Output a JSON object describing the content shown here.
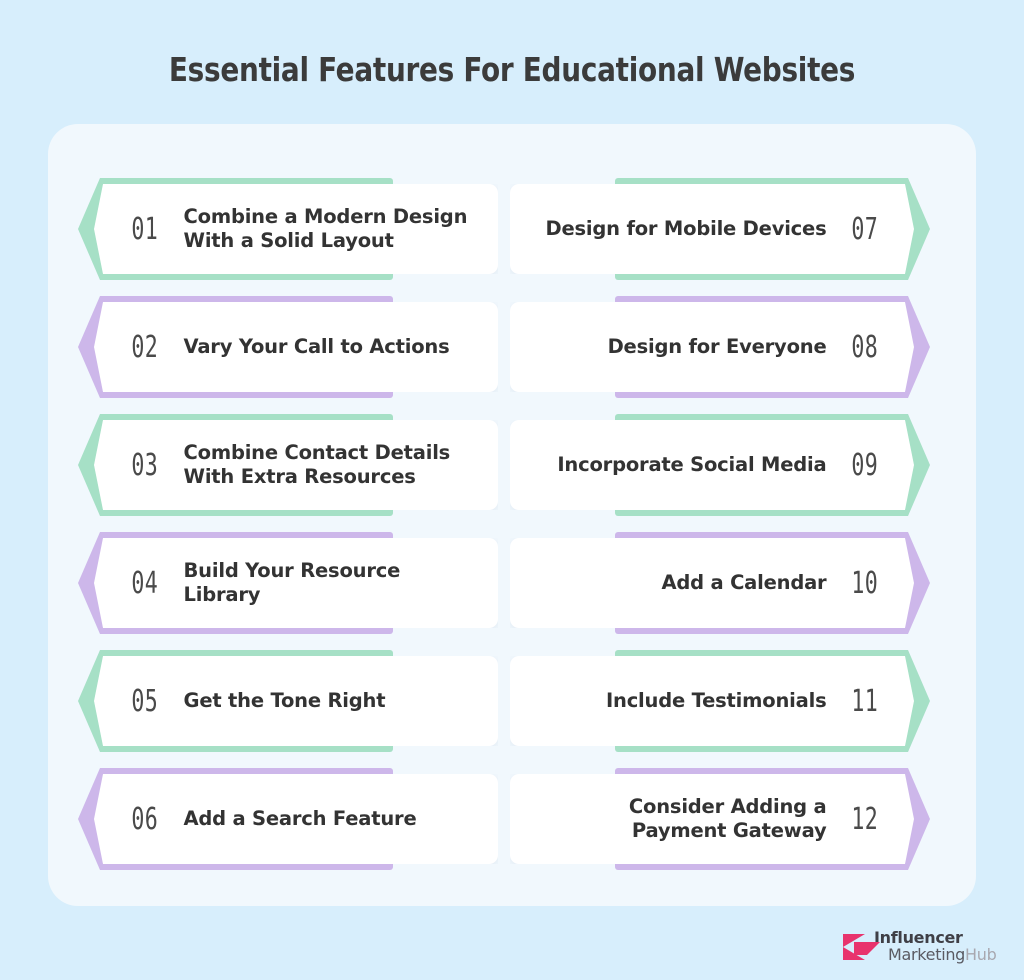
{
  "title": "Essential Features For Educational Websites",
  "colors": {
    "background": "#d7eefc",
    "panel": "#f1f8fd",
    "accent_green": "#a6e0c6",
    "accent_purple": "#cdb7ea",
    "card_white": "#ffffff",
    "title_text": "#3b3b3b",
    "label_text": "#333333",
    "number_text": "#4a4a4a",
    "logo_pink": "#e8336d"
  },
  "cards": [
    {
      "num": "01",
      "label": "Combine a Modern Design\nWith a Solid Layout",
      "side": "left",
      "accent": "green"
    },
    {
      "num": "02",
      "label": "Vary Your Call to Actions",
      "side": "left",
      "accent": "purple"
    },
    {
      "num": "03",
      "label": "Combine Contact Details\nWith Extra Resources",
      "side": "left",
      "accent": "green"
    },
    {
      "num": "04",
      "label": "Build Your Resource\nLibrary",
      "side": "left",
      "accent": "purple"
    },
    {
      "num": "05",
      "label": "Get the Tone Right",
      "side": "left",
      "accent": "green"
    },
    {
      "num": "06",
      "label": "Add a Search Feature",
      "side": "left",
      "accent": "purple"
    },
    {
      "num": "07",
      "label": "Design for Mobile Devices",
      "side": "right",
      "accent": "green"
    },
    {
      "num": "08",
      "label": "Design for Everyone",
      "side": "right",
      "accent": "purple"
    },
    {
      "num": "09",
      "label": "Incorporate Social Media",
      "side": "right",
      "accent": "green"
    },
    {
      "num": "10",
      "label": "Add a Calendar",
      "side": "right",
      "accent": "purple"
    },
    {
      "num": "11",
      "label": "Include Testimonials",
      "side": "right",
      "accent": "green"
    },
    {
      "num": "12",
      "label": "Consider Adding a\nPayment Gateway",
      "side": "right",
      "accent": "purple"
    }
  ],
  "logo": {
    "line1": "Influencer",
    "line2_dark": "Marketing",
    "line2_light": "Hub",
    "mark": "pink-arrow-logo-icon"
  }
}
